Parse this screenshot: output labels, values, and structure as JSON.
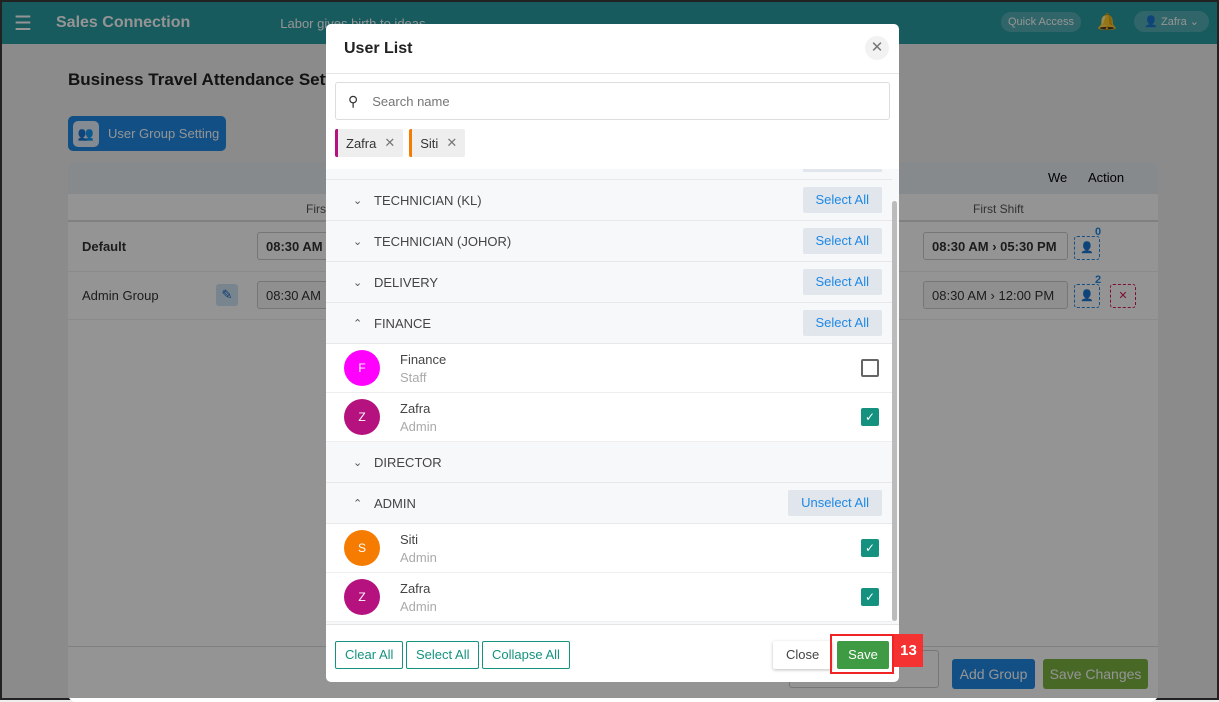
{
  "topbar": {
    "brand": "Sales Connection",
    "slogan": "Labor gives birth to ideas",
    "quick_access": "Quick Access",
    "user": "Zafra"
  },
  "page": {
    "title": "Business Travel Attendance Setting",
    "user_group_button": "User Group Setting",
    "table": {
      "header_week": "We",
      "header_action": "Action",
      "first_shift_left": "Firs",
      "first_shift": "First Shift",
      "rows": [
        {
          "name": "Default",
          "left_time": "08:30 AM",
          "shift": "08:30 AM",
          "shift_end": "05:30 PM",
          "count": "0"
        },
        {
          "name": "Admin Group",
          "left_time": "08:30 AM",
          "shift": "08:30 AM",
          "shift_end": "12:00 PM",
          "count": "2"
        }
      ]
    },
    "add_group": "Add Group",
    "save_changes": "Save Changes"
  },
  "modal": {
    "title": "User List",
    "search_placeholder": "Search name",
    "chips": [
      {
        "label": "Zafra",
        "color": "#b5127f"
      },
      {
        "label": "Siti",
        "color": "#f57c00"
      }
    ],
    "groups": [
      {
        "name": "TECHNICIAN (KL)",
        "expanded": false,
        "action": "Select All",
        "users": []
      },
      {
        "name": "TECHNICIAN (JOHOR)",
        "expanded": false,
        "action": "Select All",
        "users": []
      },
      {
        "name": "DELIVERY",
        "expanded": false,
        "action": "Select All",
        "users": []
      },
      {
        "name": "FINANCE",
        "expanded": true,
        "action": "Select All",
        "users": [
          {
            "initial": "F",
            "name": "Finance",
            "role": "Staff",
            "color": "#ff00ff",
            "checked": false
          },
          {
            "initial": "Z",
            "name": "Zafra",
            "role": "Admin",
            "color": "#b5127f",
            "checked": true
          }
        ]
      },
      {
        "name": "DIRECTOR",
        "expanded": false,
        "action": "",
        "users": []
      },
      {
        "name": "ADMIN",
        "expanded": true,
        "action": "Unselect All",
        "users": [
          {
            "initial": "S",
            "name": "Siti",
            "role": "Admin",
            "color": "#f57c00",
            "checked": true
          },
          {
            "initial": "Z",
            "name": "Zafra",
            "role": "Admin",
            "color": "#b5127f",
            "checked": true
          }
        ]
      }
    ],
    "footer": {
      "clear_all": "Clear All",
      "select_all": "Select All",
      "collapse_all": "Collapse All",
      "close": "Close",
      "save": "Save"
    }
  },
  "annotation": {
    "step": "13"
  }
}
